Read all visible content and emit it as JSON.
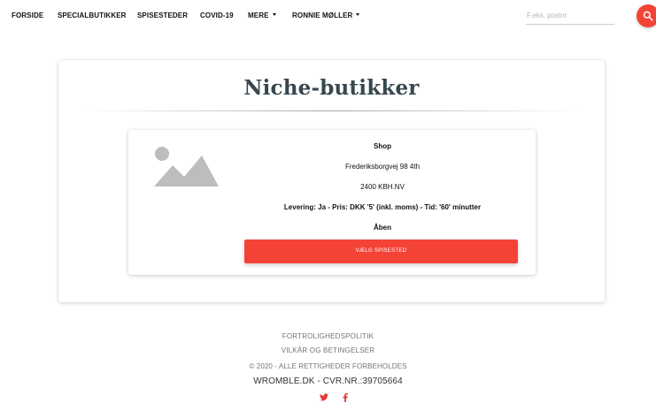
{
  "nav": {
    "items": [
      {
        "label": "FORSIDE"
      },
      {
        "label": "SPECIALBUTIKKER"
      },
      {
        "label": "SPISESTEDER"
      },
      {
        "label": "COVID-19"
      },
      {
        "label": "MERE"
      },
      {
        "label": "RONNIE MØLLER"
      }
    ],
    "search_placeholder": "F.eks. postnr.",
    "search_icon": "search-icon"
  },
  "main": {
    "title": "Niche-butikker",
    "shop": {
      "image_icon": "image-placeholder-icon",
      "name": "Shop",
      "address": "Frederiksborgvej 98 4th",
      "postal": "2400 KBH.NV",
      "delivery": "Levering: Ja - Pris: DKK '5' (inkl. moms) - Tid: '60' minutter",
      "status": "Åben",
      "button_label": "VÆLG SPISESTED"
    }
  },
  "footer": {
    "privacy": "FORTROLIGHEDSPOLITIK",
    "terms": "VILKÅR OG BETINGELSER",
    "copyright": "© 2020 - ALLE RETTIGHEDER FORBEHOLDES",
    "company": "WROMBLE.DK - CVR.NR.:39705664",
    "social": [
      {
        "icon": "twitter-icon"
      },
      {
        "icon": "facebook-icon"
      }
    ]
  },
  "colors": {
    "accent": "#f44336",
    "title": "#37474f",
    "muted": "#757575"
  }
}
